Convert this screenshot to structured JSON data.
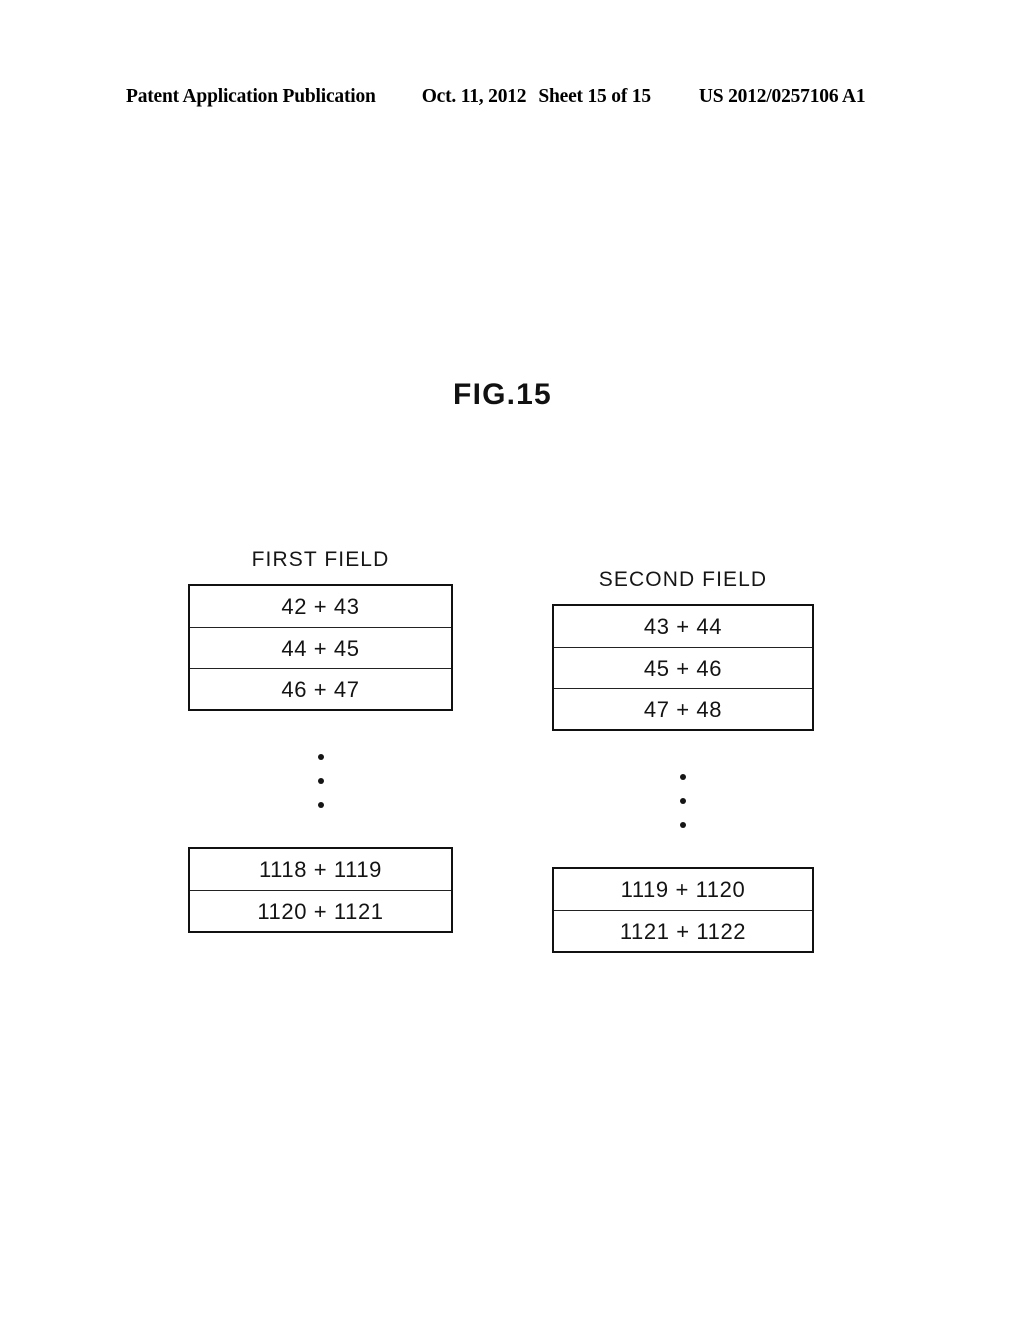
{
  "header": {
    "publication": "Patent Application Publication",
    "date": "Oct. 11, 2012",
    "sheet": "Sheet 15 of 15",
    "patent_number": "US 2012/0257106 A1"
  },
  "figure": {
    "title": "FIG.15"
  },
  "fields": [
    {
      "label": "FIRST FIELD",
      "top_rows": [
        "42 + 43",
        "44 + 45",
        "46 + 47"
      ],
      "ellipsis_dots": 3,
      "bottom_rows": [
        "1118 + 1119",
        "1120 + 1121"
      ]
    },
    {
      "label": "SECOND FIELD",
      "top_rows": [
        "43 + 44",
        "45 + 46",
        "47 + 48"
      ],
      "ellipsis_dots": 3,
      "bottom_rows": [
        "1119 + 1120",
        "1121 + 1122"
      ]
    }
  ],
  "colors": {
    "page_background": "#ffffff",
    "ink": "#111111",
    "border": "#111111"
  }
}
